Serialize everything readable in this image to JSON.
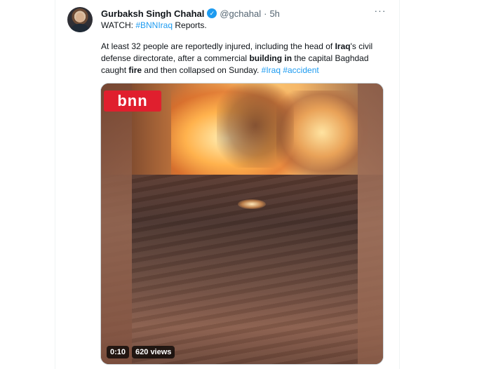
{
  "author": {
    "name": "Gurbaksh Singh Chahal",
    "handle": "@gchahal",
    "separator": "·",
    "time": "5h",
    "verified_icon": "verified-badge-icon"
  },
  "more_icon": "more-options-icon",
  "more_glyph": "···",
  "tweet": {
    "watch_prefix": "WATCH: ",
    "watch_hashtag": "#BNNIraq",
    "watch_suffix": " Reports.",
    "p1": "At least 32 people are reportedly injured, including the head of ",
    "b1": "Iraq",
    "p2": "'s civil defense directorate, after a commercial ",
    "b2": "building in",
    "p3": " the capital Baghdad caught ",
    "b3": "fire",
    "p4": " and then collapsed on Sunday. ",
    "h1": "#Iraq",
    "h2": " #accident"
  },
  "media": {
    "logo_text": "bnn",
    "duration": "0:10",
    "views": "620 views"
  },
  "colors": {
    "link": "#1d9bf0",
    "text": "#0f1419",
    "secondary": "#536471",
    "logo_red": "#e01f2e"
  }
}
